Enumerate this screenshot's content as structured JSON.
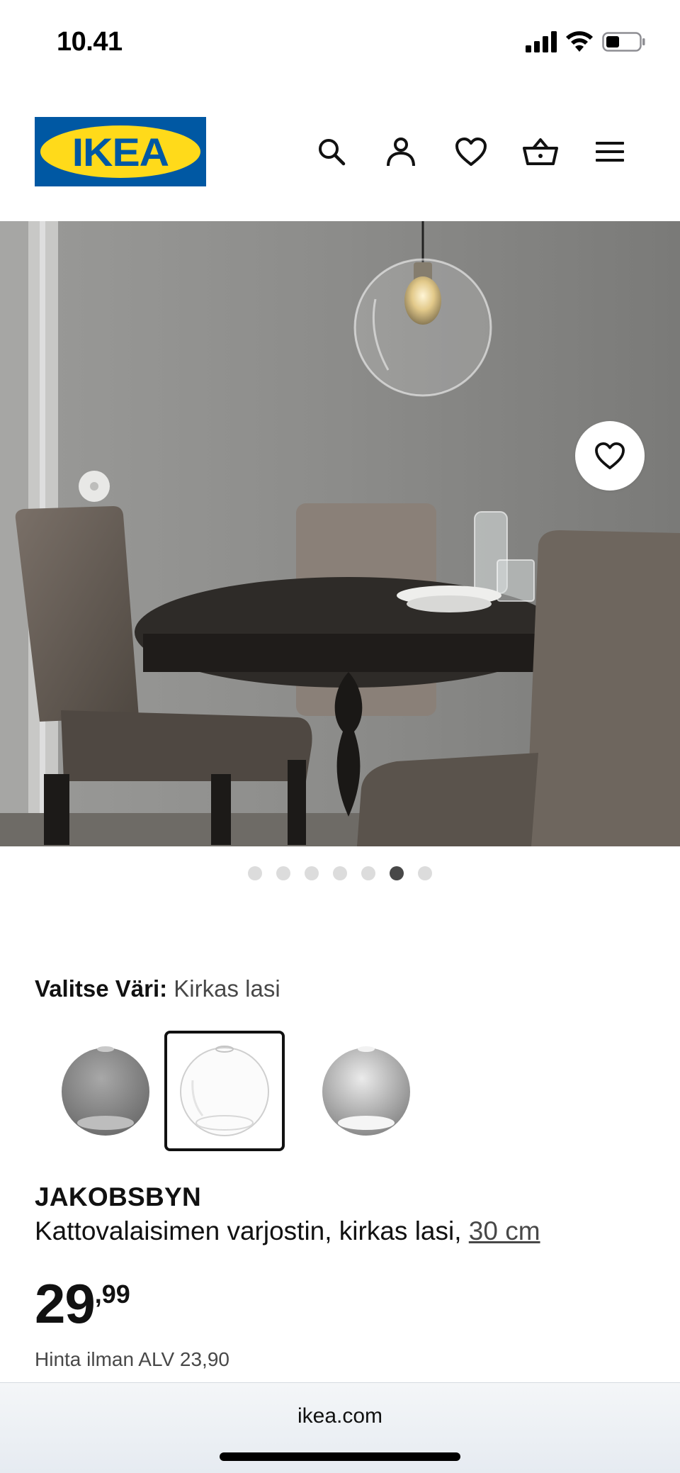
{
  "status_bar": {
    "time": "10.41",
    "icons": [
      "cellular-signal-icon",
      "wifi-icon",
      "battery-icon"
    ]
  },
  "header": {
    "logo_text": "IKEA",
    "icons": [
      "search-icon",
      "account-icon",
      "heart-icon",
      "basket-icon",
      "menu-icon"
    ]
  },
  "gallery": {
    "dot_count": 7,
    "active_index": 5
  },
  "color": {
    "label": "Valitse Väri:",
    "value": "Kirkas lasi",
    "swatches": [
      "grey glass",
      "clear glass",
      "smoked glass"
    ],
    "selected_index": 1
  },
  "product": {
    "name": "JAKOBSBYN",
    "description": "Kattovalaisimen varjostin, kirkas lasi,",
    "size": "30 cm",
    "price_integer": "29",
    "price_decimal": ",99",
    "vat_text": "Hinta ilman ALV 23,90"
  },
  "browser": {
    "url": "ikea.com"
  },
  "colors": {
    "ikea_blue": "#0058a3",
    "ikea_yellow": "#ffda1a",
    "text_dark": "#111111",
    "text_grey": "#484848"
  }
}
